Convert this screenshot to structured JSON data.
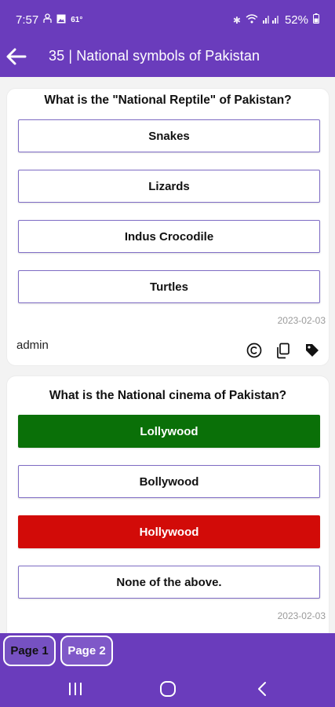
{
  "status_bar": {
    "time": "7:57",
    "temperature": "61°",
    "battery": "52%",
    "icons": [
      "person-icon",
      "image-icon",
      "bluetooth-icon",
      "wifi-icon",
      "signal-icon",
      "battery-icon"
    ]
  },
  "app_bar": {
    "title": "35 | National symbols of Pakistan",
    "back_icon": "arrow-left-icon"
  },
  "cards": [
    {
      "question": "What is the \"National Reptile\" of Pakistan?",
      "options": [
        "Snakes",
        "Lizards",
        "Indus Crocodile",
        "Turtles"
      ],
      "date": "2023-02-03",
      "author": "admin",
      "icons": [
        "copyright-icon",
        "copy-icon",
        "tag-icon"
      ]
    },
    {
      "question": "What is the National cinema of Pakistan?",
      "options": [
        "Lollywood",
        "Bollywood",
        "Hollywood",
        "None of the above."
      ],
      "option_states": [
        "correct",
        "neutral",
        "wrong",
        "neutral"
      ],
      "date": "2023-02-03"
    }
  ],
  "pager": {
    "pages": [
      "Page 1",
      "Page 2"
    ],
    "active_page": "Page 1"
  },
  "colors": {
    "primary": "#6a3cbc",
    "correct": "#0a7008",
    "wrong": "#d20b08",
    "option_border": "#7e6cc4"
  },
  "nav_bar": {
    "icons": [
      "recents-icon",
      "home-icon",
      "back-icon"
    ]
  }
}
